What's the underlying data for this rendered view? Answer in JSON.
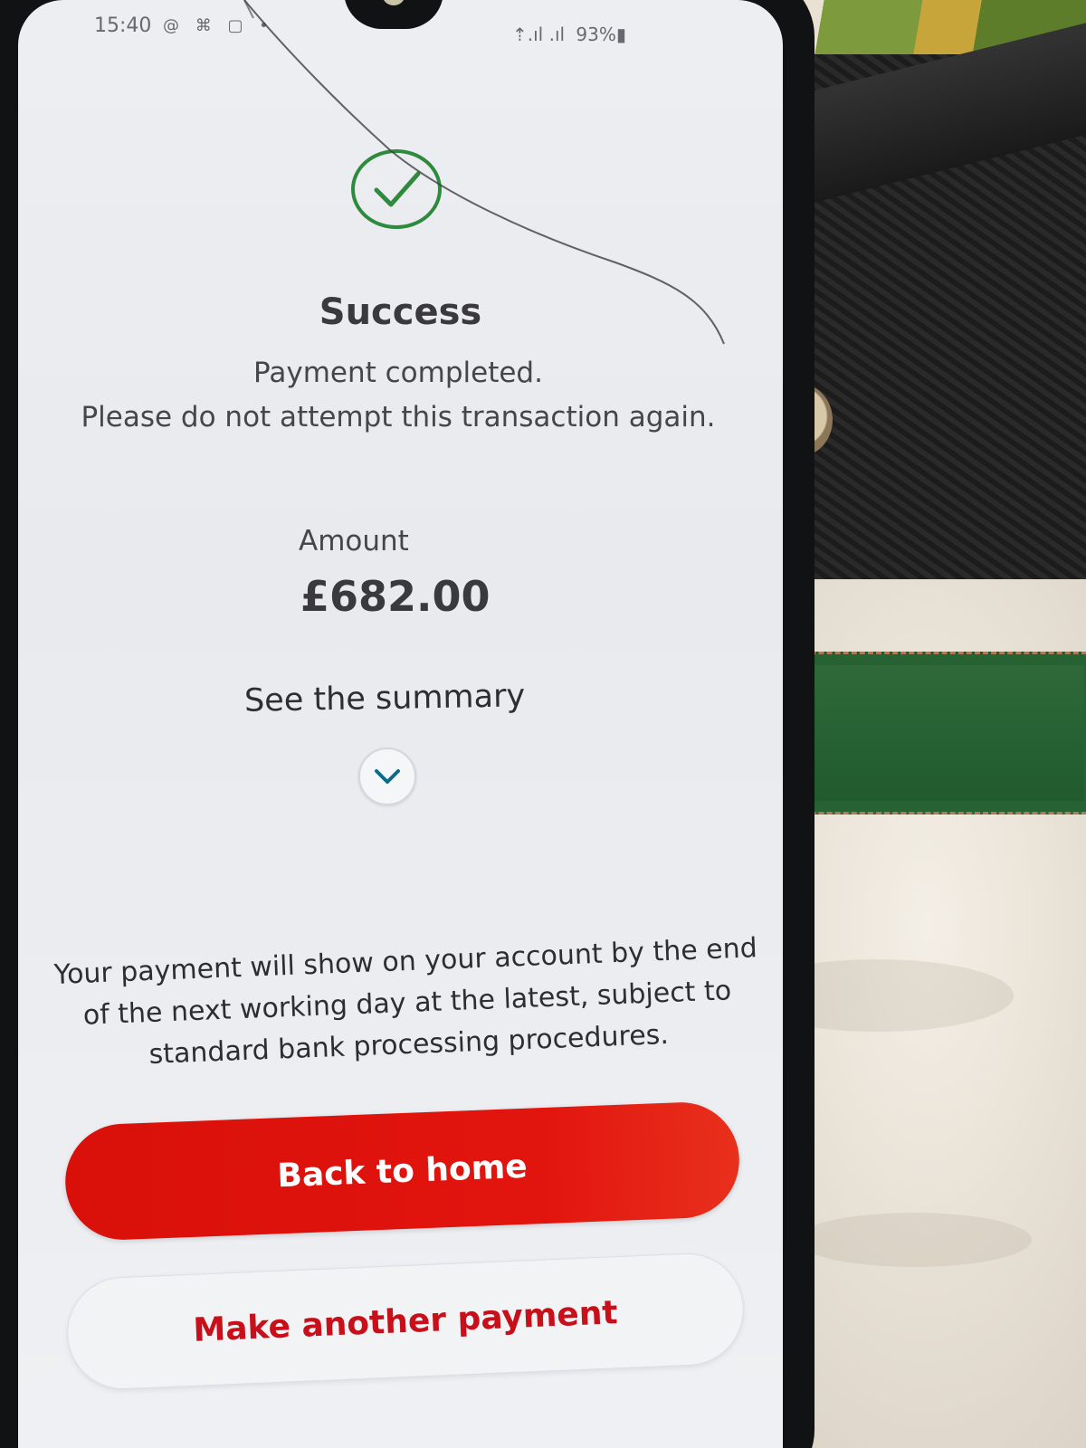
{
  "statusbar": {
    "time": "15:40",
    "icons": "@ ⌘ ▢ •",
    "signal": "⇡.ıl .ıl",
    "battery": "93%▮"
  },
  "result": {
    "icon": "checkmark-circle-icon",
    "title": "Success",
    "message": "Payment completed.\nPlease do not attempt this transaction again."
  },
  "amount": {
    "label": "Amount",
    "value": "£682.00"
  },
  "summary": {
    "label": "See the summary",
    "toggle_icon": "chevron-down-icon"
  },
  "notice": "Your payment will show on your account by the end of the next working day at the latest, subject to standard bank processing procedures.",
  "actions": {
    "primary_label": "Back to home",
    "secondary_label": "Make another payment"
  },
  "colors": {
    "brand_red": "#e2140e",
    "success_green": "#2e8b3d",
    "toggle_accent": "#0a6c86"
  }
}
